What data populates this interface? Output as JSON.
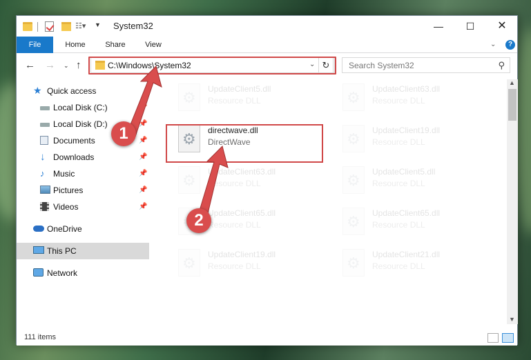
{
  "window": {
    "title": "System32",
    "minimize_glyph": "—",
    "maximize_glyph": "☐",
    "close_glyph": "✕"
  },
  "ribbon": {
    "tabs": [
      "File",
      "Home",
      "Share",
      "View"
    ],
    "expand_glyph": "⌄",
    "help_glyph": "?"
  },
  "navigation": {
    "back_glyph": "←",
    "forward_glyph": "→",
    "recent_glyph": "⌄",
    "up_glyph": "↑",
    "address": "C:\\Windows\\System32",
    "address_dropdown_glyph": "⌄",
    "refresh_glyph": "↻",
    "search_placeholder": "Search System32",
    "search_glyph": "⚲"
  },
  "nav_pane": {
    "quick_access": "Quick access",
    "items": [
      {
        "label": "Local Disk (C:)",
        "icon": "drive-icon",
        "pinned": true
      },
      {
        "label": "Local Disk (D:)",
        "icon": "drive-icon",
        "pinned": true
      },
      {
        "label": "Documents",
        "icon": "documents-icon",
        "pinned": true
      },
      {
        "label": "Downloads",
        "icon": "downloads-icon",
        "pinned": true
      },
      {
        "label": "Music",
        "icon": "music-icon",
        "pinned": true
      },
      {
        "label": "Pictures",
        "icon": "pictures-icon",
        "pinned": true
      },
      {
        "label": "Videos",
        "icon": "videos-icon",
        "pinned": true
      }
    ],
    "onedrive": "OneDrive",
    "this_pc": "This PC",
    "network": "Network",
    "pin_glyph": "📌"
  },
  "files": {
    "left_column": [
      {
        "name": "UpdateClient5.dll",
        "type": "Resource DLL"
      },
      {
        "name": "directwave.dll",
        "type": "DirectWave",
        "highlighted": true
      },
      {
        "name": "UpdateClient63.dll",
        "type": "Resource DLL"
      },
      {
        "name": "UpdateClient65.dll",
        "type": "Resource DLL"
      },
      {
        "name": "UpdateClient19.dll",
        "type": "Resource DLL"
      }
    ],
    "right_column": [
      {
        "name": "UpdateClient63.dll",
        "type": "Resource DLL"
      },
      {
        "name": "UpdateClient19.dll",
        "type": "Resource DLL"
      },
      {
        "name": "UpdateClient5.dll",
        "type": "Resource DLL"
      },
      {
        "name": "UpdateClient65.dll",
        "type": "Resource DLL"
      },
      {
        "name": "UpdateClient21.dll",
        "type": "Resource DLL"
      }
    ]
  },
  "status": {
    "item_count": "111 items"
  },
  "callouts": {
    "step1": "1",
    "step2": "2",
    "color": "#d94d4d"
  },
  "colors": {
    "accent": "#1979ca",
    "highlight_border": "#d04848"
  }
}
